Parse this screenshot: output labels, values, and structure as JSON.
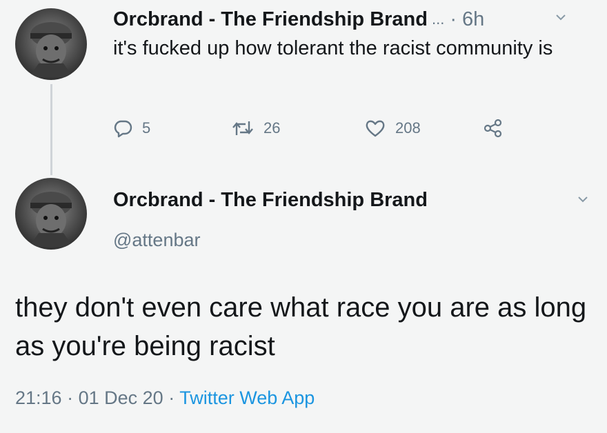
{
  "tweet1": {
    "author_name": "Orcbrand - The Friendship Brand",
    "ellipsis": "...",
    "time": "· 6h",
    "text": "it's fucked up how tolerant the racist community is",
    "reply_count": "5",
    "retweet_count": "26",
    "like_count": "208",
    "icons": [
      "reply-icon",
      "retweet-icon",
      "like-icon",
      "share-icon",
      "chevron-down-icon"
    ]
  },
  "tweet2": {
    "author_name": "Orcbrand - The Friendship Brand",
    "handle": "@attenbar",
    "text": "they don't even care what race you are as long as you're being racist",
    "time": "21:16",
    "date": "01 Dec 20",
    "separator": "·",
    "source": "Twitter Web App"
  },
  "colors": {
    "background": "#f4f5f5",
    "text": "#14171a",
    "secondary": "#657786",
    "link": "#1b95e0"
  }
}
